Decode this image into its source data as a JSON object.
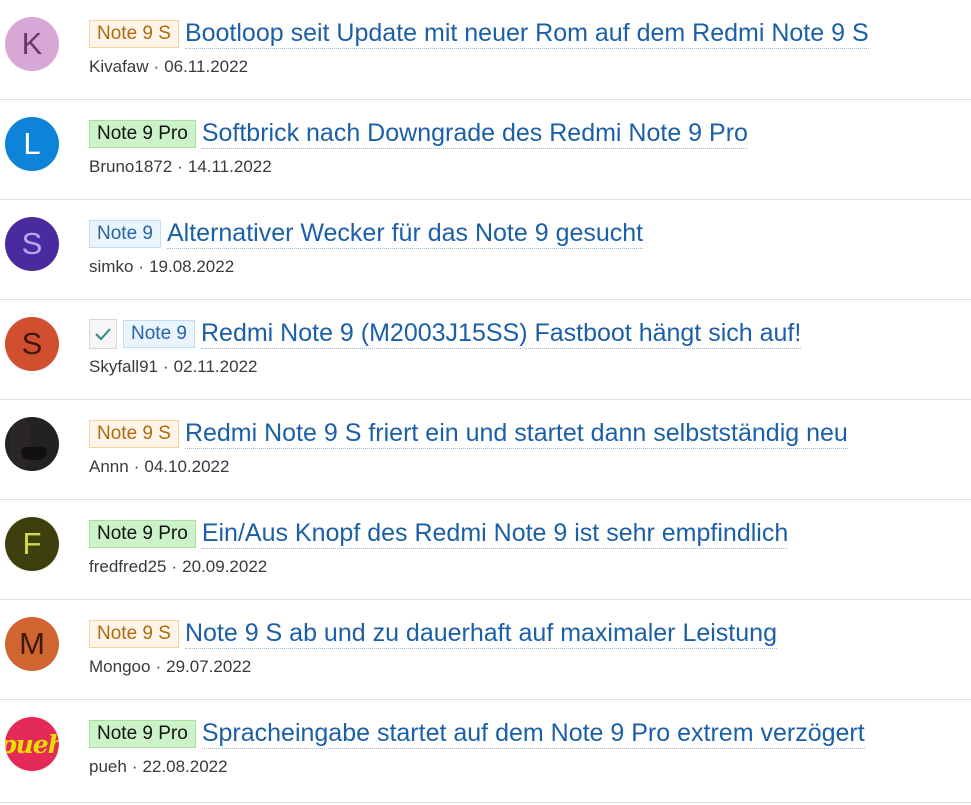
{
  "threads": [
    {
      "avatar_letter": "K",
      "avatar_type": "letter",
      "avatar_bg": "#d8a7d6",
      "avatar_fg": "#6d3671",
      "prefix": "Note 9 S",
      "prefix_color": "orange",
      "solved": false,
      "title": "Bootloop seit Update mit neuer Rom auf dem Redmi Note 9 S",
      "author": "Kivafaw",
      "separator": "·",
      "date": "06.11.2022"
    },
    {
      "avatar_letter": "L",
      "avatar_type": "letter",
      "avatar_bg": "#0d84d8",
      "avatar_fg": "#ffffff",
      "prefix": "Note 9 Pro",
      "prefix_color": "green",
      "solved": false,
      "title": "Softbrick nach Downgrade des Redmi Note 9 Pro",
      "author": "Bruno1872",
      "separator": "·",
      "date": "14.11.2022"
    },
    {
      "avatar_letter": "S",
      "avatar_type": "letter",
      "avatar_bg": "#4a2a9f",
      "avatar_fg": "#b8a6ee",
      "prefix": "Note 9",
      "prefix_color": "blue",
      "solved": false,
      "title": "Alternativer Wecker für das Note 9 gesucht",
      "author": "simko",
      "separator": "·",
      "date": "19.08.2022"
    },
    {
      "avatar_letter": "S",
      "avatar_type": "letter",
      "avatar_bg": "#cf4f2f",
      "avatar_fg": "#45160c",
      "prefix": "Note 9",
      "prefix_color": "blue",
      "solved": true,
      "title": "Redmi Note 9 (M2003J15SS) Fastboot hängt sich auf!",
      "author": "Skyfall91",
      "separator": "·",
      "date": "02.11.2022"
    },
    {
      "avatar_letter": "",
      "avatar_type": "photo",
      "avatar_bg": "#222222",
      "avatar_fg": "#ffffff",
      "prefix": "Note 9 S",
      "prefix_color": "orange",
      "solved": false,
      "title": "Redmi Note 9 S friert ein und startet dann selbstständig neu",
      "author": "Annn",
      "separator": "·",
      "date": "04.10.2022"
    },
    {
      "avatar_letter": "F",
      "avatar_type": "letter",
      "avatar_bg": "#3d3f0f",
      "avatar_fg": "#d6d84a",
      "prefix": "Note 9 Pro",
      "prefix_color": "green",
      "solved": false,
      "title": "Ein/Aus Knopf des Redmi Note 9 ist sehr empfindlich",
      "author": "fredfred25",
      "separator": "·",
      "date": "20.09.2022"
    },
    {
      "avatar_letter": "M",
      "avatar_type": "letter",
      "avatar_bg": "#d0662f",
      "avatar_fg": "#3f1708",
      "prefix": "Note 9 S",
      "prefix_color": "orange",
      "solved": false,
      "title": "Note 9 S ab und zu dauerhaft auf maximaler Leistung",
      "author": "Mongoo",
      "separator": "·",
      "date": "29.07.2022"
    },
    {
      "avatar_letter": "pueh",
      "avatar_type": "logo",
      "avatar_bg": "#e52a57",
      "avatar_fg": "#e6e000",
      "prefix": "Note 9 Pro",
      "prefix_color": "green",
      "solved": false,
      "title": "Spracheingabe startet auf dem Note 9 Pro extrem verzögert",
      "author": "pueh",
      "separator": "·",
      "date": "22.08.2022"
    }
  ]
}
